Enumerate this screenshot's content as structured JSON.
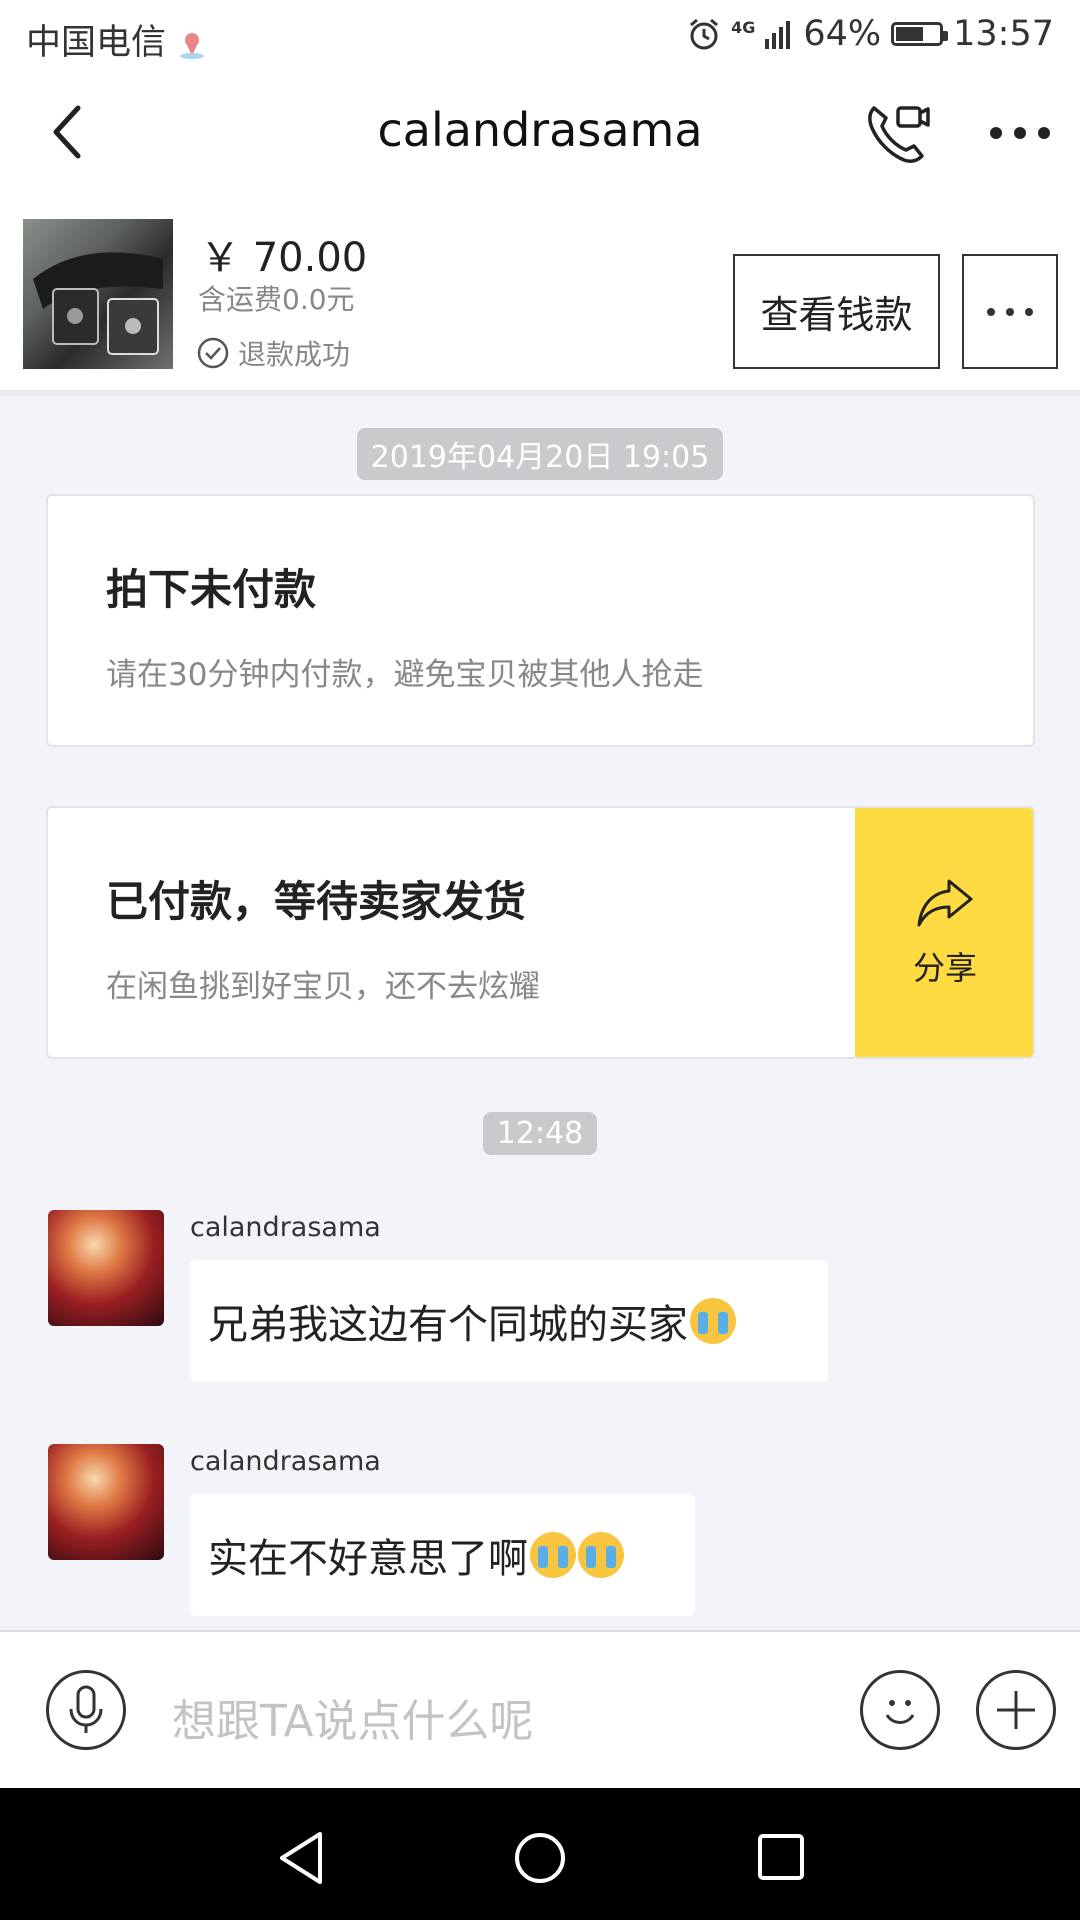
{
  "status_bar": {
    "carrier": "中国电信",
    "network": "4G",
    "battery": "64%",
    "battery_level": 0.64,
    "time": "13:57"
  },
  "header": {
    "title": "calandrasama"
  },
  "product": {
    "price": "￥ 70.00",
    "shipping": "含运费0.0元",
    "status": "退款成功",
    "view_button": "查看钱款"
  },
  "chat": {
    "timestamp_1": "2019年04月20日 19:05",
    "card_unpaid": {
      "title": "拍下未付款",
      "subtitle": "请在30分钟内付款，避免宝贝被其他人抢走"
    },
    "card_paid": {
      "title": "已付款，等待卖家发货",
      "subtitle": "在闲鱼挑到好宝贝，还不去炫耀",
      "share_label": "分享"
    },
    "timestamp_2": "12:48",
    "messages": [
      {
        "sender": "calandrasama",
        "text": "兄弟我这边有个同城的买家",
        "emoji_count": 1
      },
      {
        "sender": "calandrasama",
        "text": "实在不好意思了啊",
        "emoji_count": 2
      }
    ]
  },
  "input": {
    "placeholder": "想跟TA说点什么呢"
  },
  "colors": {
    "accent_yellow": "#fedb43",
    "background": "#f3f4f9",
    "timestamp_bg": "#c9cacd"
  }
}
